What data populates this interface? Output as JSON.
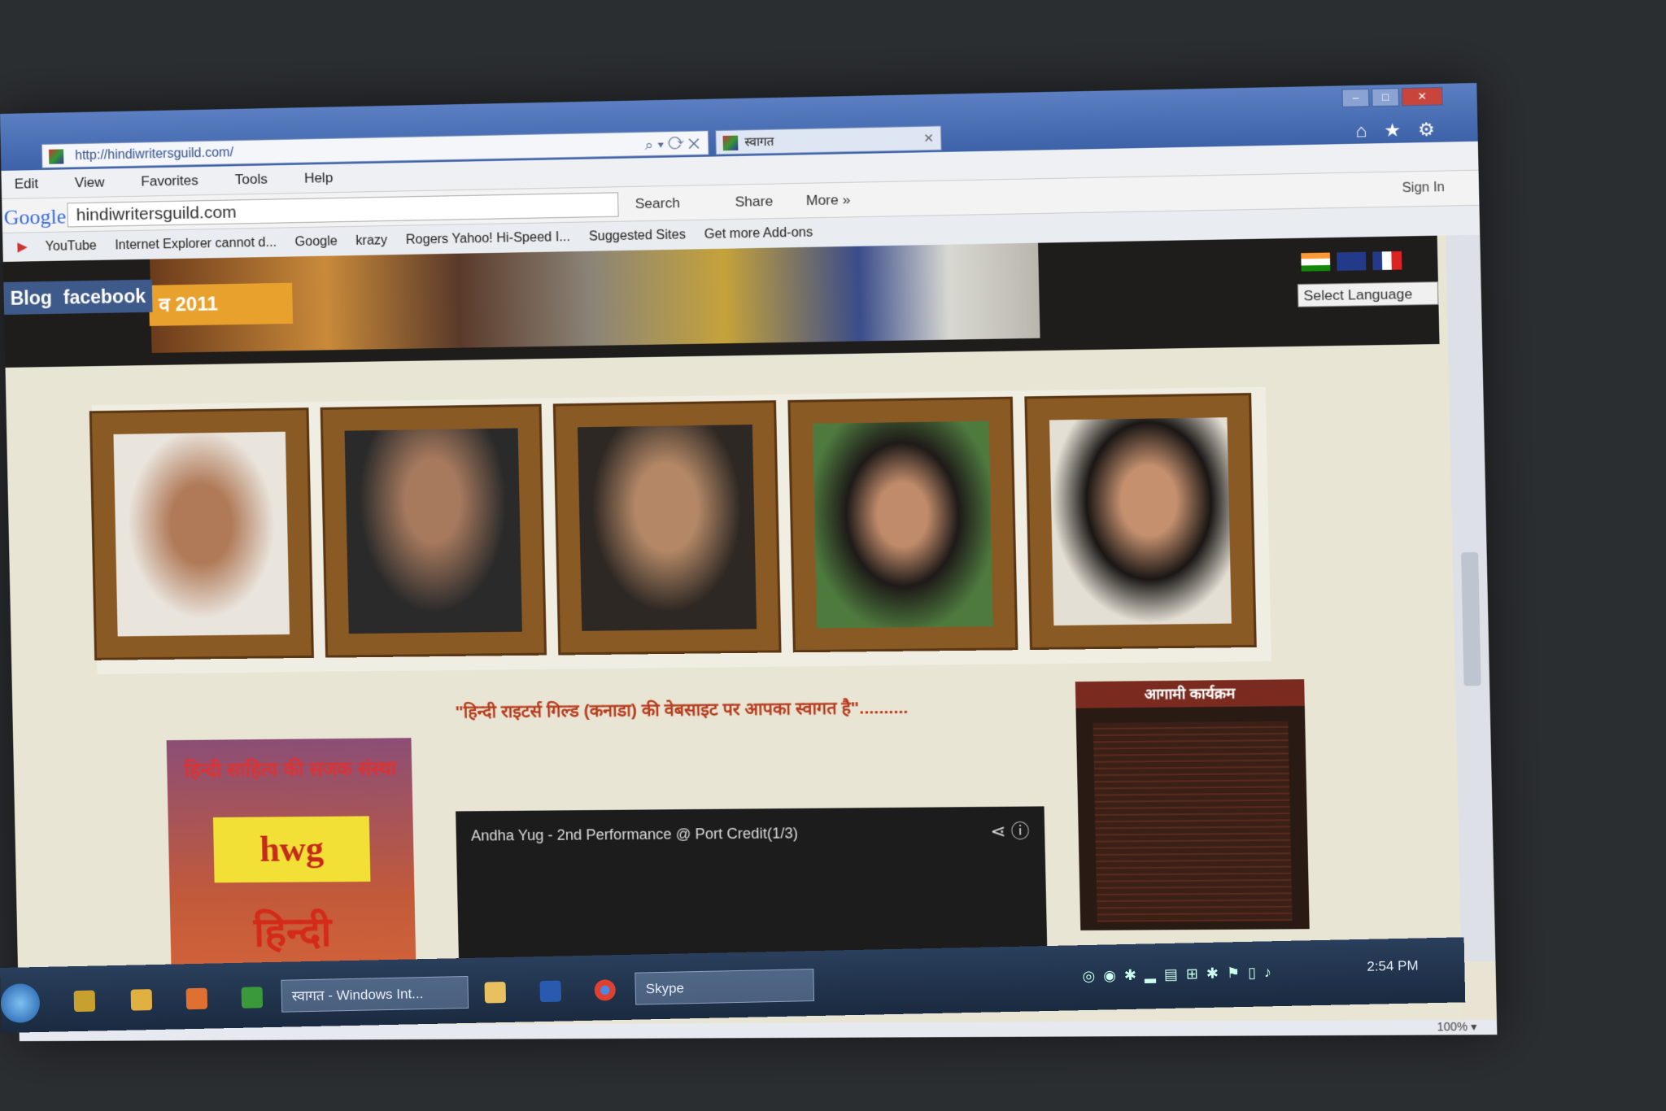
{
  "browser": {
    "url": "http://hindiwritersguild.com/",
    "tab_title": "स्वागत",
    "menu": [
      "Edit",
      "View",
      "Favorites",
      "Tools",
      "Help"
    ],
    "google_logo": "Google",
    "google_query": "hindiwritersguild.com",
    "google_buttons": {
      "search": "Search",
      "share": "Share",
      "more": "More »"
    },
    "sign_in": "Sign In",
    "favorites": [
      "YouTube",
      "Internet Explorer cannot d...",
      "Google",
      "krazy",
      "Rogers Yahoo! Hi-Speed I...",
      "Suggested Sites",
      "Get more Add-ons"
    ],
    "zoom": "100%"
  },
  "site": {
    "nav": {
      "blog": "Blog",
      "facebook": "facebook"
    },
    "year_badge": "व 2011",
    "language_select": "Select Language",
    "welcome": "\"हिन्दी राइटर्स गिल्ड (कनाडा) की वेबसाइट पर आपका स्वागत है\"..........",
    "poster": {
      "title": "हिन्दी साहित्य की सजक संस्था",
      "logo": "hwg",
      "subtitle": "हिन्दी"
    },
    "video_title": "Andha Yug - 2nd Performance @ Port Credit(1/3)",
    "events_heading": "आगामी कार्यक्रम",
    "portraits": 5
  },
  "taskbar": {
    "tasks": [
      "स्वागत - Windows Int...",
      "Skype"
    ],
    "clock": "2:54 PM"
  },
  "colors": {
    "frame_gold": "#8a5a24",
    "banner_orange": "#e8a12c",
    "welcome_red": "#b63a1c"
  }
}
